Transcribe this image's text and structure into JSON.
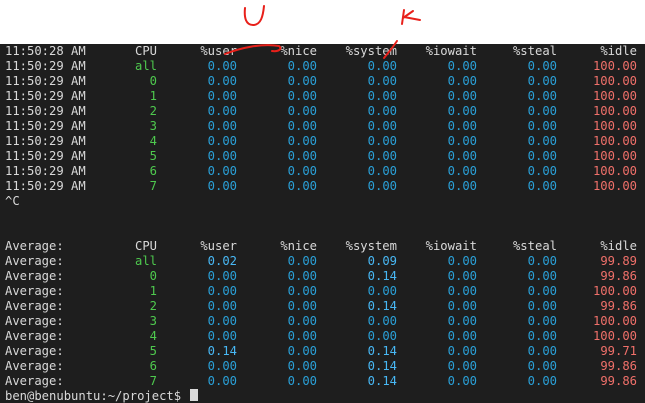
{
  "annotations": {
    "mark_user": "U",
    "mark_system": "K",
    "color": "#e8201a"
  },
  "columns": [
    "CPU",
    "%user",
    "%nice",
    "%system",
    "%iowait",
    "%steal",
    "%idle"
  ],
  "colors": {
    "label": "#d9d9d9",
    "cpu": "#4ec94e",
    "zero": "#2aa0d8",
    "nonzero": "#48b8f5",
    "idle": "#f0706a"
  },
  "snapshot": {
    "header_time": "11:50:28 AM",
    "rows": [
      {
        "time": "11:50:29 AM",
        "cpu": "all",
        "user": "0.00",
        "nice": "0.00",
        "system": "0.00",
        "iowait": "0.00",
        "steal": "0.00",
        "idle": "100.00"
      },
      {
        "time": "11:50:29 AM",
        "cpu": "0",
        "user": "0.00",
        "nice": "0.00",
        "system": "0.00",
        "iowait": "0.00",
        "steal": "0.00",
        "idle": "100.00"
      },
      {
        "time": "11:50:29 AM",
        "cpu": "1",
        "user": "0.00",
        "nice": "0.00",
        "system": "0.00",
        "iowait": "0.00",
        "steal": "0.00",
        "idle": "100.00"
      },
      {
        "time": "11:50:29 AM",
        "cpu": "2",
        "user": "0.00",
        "nice": "0.00",
        "system": "0.00",
        "iowait": "0.00",
        "steal": "0.00",
        "idle": "100.00"
      },
      {
        "time": "11:50:29 AM",
        "cpu": "3",
        "user": "0.00",
        "nice": "0.00",
        "system": "0.00",
        "iowait": "0.00",
        "steal": "0.00",
        "idle": "100.00"
      },
      {
        "time": "11:50:29 AM",
        "cpu": "4",
        "user": "0.00",
        "nice": "0.00",
        "system": "0.00",
        "iowait": "0.00",
        "steal": "0.00",
        "idle": "100.00"
      },
      {
        "time": "11:50:29 AM",
        "cpu": "5",
        "user": "0.00",
        "nice": "0.00",
        "system": "0.00",
        "iowait": "0.00",
        "steal": "0.00",
        "idle": "100.00"
      },
      {
        "time": "11:50:29 AM",
        "cpu": "6",
        "user": "0.00",
        "nice": "0.00",
        "system": "0.00",
        "iowait": "0.00",
        "steal": "0.00",
        "idle": "100.00"
      },
      {
        "time": "11:50:29 AM",
        "cpu": "7",
        "user": "0.00",
        "nice": "0.00",
        "system": "0.00",
        "iowait": "0.00",
        "steal": "0.00",
        "idle": "100.00"
      }
    ]
  },
  "interrupt_text": "^C",
  "average": {
    "label": "Average:",
    "rows": [
      {
        "cpu": "all",
        "user": "0.02",
        "nice": "0.00",
        "system": "0.09",
        "iowait": "0.00",
        "steal": "0.00",
        "idle": "99.89"
      },
      {
        "cpu": "0",
        "user": "0.00",
        "nice": "0.00",
        "system": "0.14",
        "iowait": "0.00",
        "steal": "0.00",
        "idle": "99.86"
      },
      {
        "cpu": "1",
        "user": "0.00",
        "nice": "0.00",
        "system": "0.00",
        "iowait": "0.00",
        "steal": "0.00",
        "idle": "100.00"
      },
      {
        "cpu": "2",
        "user": "0.00",
        "nice": "0.00",
        "system": "0.14",
        "iowait": "0.00",
        "steal": "0.00",
        "idle": "99.86"
      },
      {
        "cpu": "3",
        "user": "0.00",
        "nice": "0.00",
        "system": "0.00",
        "iowait": "0.00",
        "steal": "0.00",
        "idle": "100.00"
      },
      {
        "cpu": "4",
        "user": "0.00",
        "nice": "0.00",
        "system": "0.00",
        "iowait": "0.00",
        "steal": "0.00",
        "idle": "100.00"
      },
      {
        "cpu": "5",
        "user": "0.14",
        "nice": "0.00",
        "system": "0.14",
        "iowait": "0.00",
        "steal": "0.00",
        "idle": "99.71"
      },
      {
        "cpu": "6",
        "user": "0.00",
        "nice": "0.00",
        "system": "0.14",
        "iowait": "0.00",
        "steal": "0.00",
        "idle": "99.86"
      },
      {
        "cpu": "7",
        "user": "0.00",
        "nice": "0.00",
        "system": "0.14",
        "iowait": "0.00",
        "steal": "0.00",
        "idle": "99.86"
      }
    ]
  },
  "prompt": {
    "text": "ben@benubuntu:~/project$ "
  }
}
